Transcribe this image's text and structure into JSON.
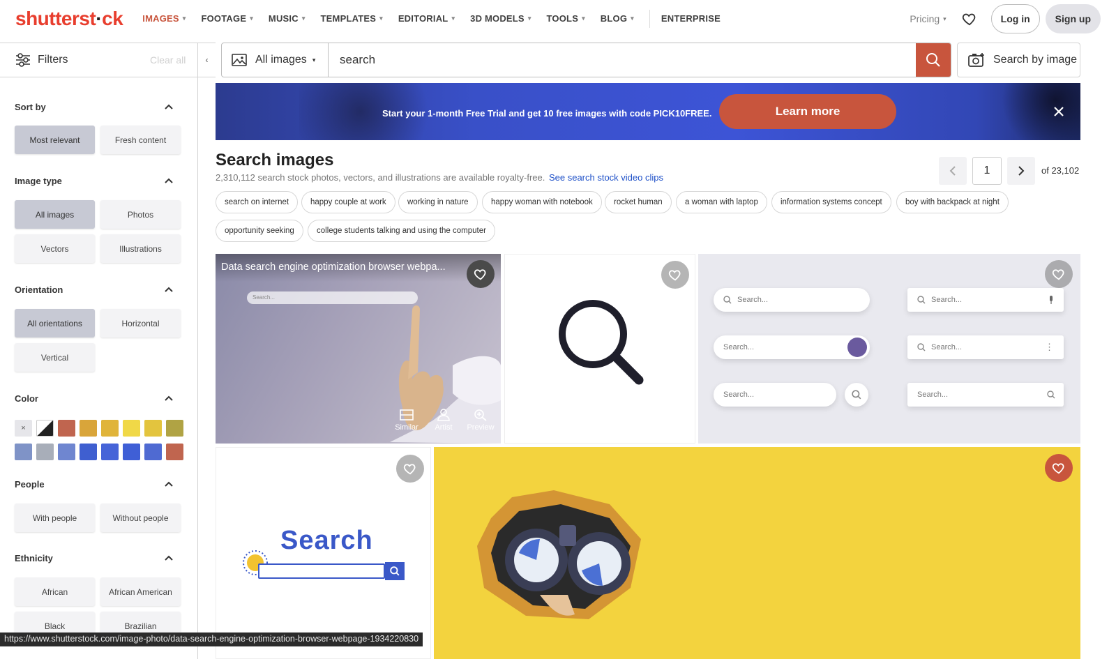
{
  "brand": {
    "logo_main": "shutterst",
    "logo_mid": "ck",
    "accent": "#c8553d",
    "logo_red": "#e83e2e"
  },
  "nav": {
    "items": [
      {
        "label": "IMAGES",
        "active": true,
        "caret": true
      },
      {
        "label": "FOOTAGE",
        "caret": true
      },
      {
        "label": "MUSIC",
        "caret": true
      },
      {
        "label": "TEMPLATES",
        "caret": true
      },
      {
        "label": "EDITORIAL",
        "caret": true
      },
      {
        "label": "3D MODELS",
        "caret": true
      },
      {
        "label": "TOOLS",
        "caret": true
      },
      {
        "label": "BLOG",
        "caret": true
      }
    ],
    "enterprise": "ENTERPRISE",
    "pricing": "Pricing",
    "login": "Log in",
    "signup": "Sign up"
  },
  "filters": {
    "title": "Filters",
    "clear_all": "Clear all",
    "sort": {
      "label": "Sort by",
      "options": [
        "Most relevant",
        "Fresh content"
      ],
      "selected": "Most relevant"
    },
    "image_type": {
      "label": "Image type",
      "options": [
        "All images",
        "Photos",
        "Vectors",
        "Illustrations"
      ],
      "selected": "All images"
    },
    "orientation": {
      "label": "Orientation",
      "options": [
        "All orientations",
        "Horizontal",
        "Vertical"
      ],
      "selected": "All orientations"
    },
    "color": {
      "label": "Color",
      "clear_glyph": "×",
      "swatches_row1": [
        "#ffffff/#222222",
        "#c0654f",
        "#d9a53a",
        "#e0b43a",
        "#f0d847",
        "#e3c43e",
        "#b0a344"
      ],
      "swatches_row2": [
        "#7f93c7",
        "#a8aeb9",
        "#6f86d0",
        "#3f5fd0",
        "#4664d8",
        "#3f5fd6",
        "#4f6ad2",
        "#c0654f"
      ]
    },
    "people": {
      "label": "People",
      "options": [
        "With people",
        "Without people"
      ]
    },
    "ethnicity": {
      "label": "Ethnicity",
      "options": [
        "African",
        "African American",
        "Black",
        "Brazilian"
      ]
    }
  },
  "search": {
    "type_label": "All images",
    "query": "search",
    "by_image": "Search by image"
  },
  "promo": {
    "text": "Start your 1-month Free Trial and get 10 free images with code PICK10FREE.",
    "cta": "Learn more"
  },
  "results": {
    "title": "Search images",
    "subtitle": "2,310,112 search stock photos, vectors, and illustrations are available royalty-free.",
    "video_link": "See search stock video clips",
    "page": "1",
    "of_pages": "of 23,102"
  },
  "related": [
    "search on internet",
    "happy couple at work",
    "working in nature",
    "happy woman with notebook",
    "rocket human",
    "a woman with laptop",
    "information systems concept",
    "boy with backpack at night",
    "opportunity seeking",
    "college students talking and using the computer"
  ],
  "tiles": {
    "first_caption": "Data search engine optimization browser webpa...",
    "first_mock_search": "Search...",
    "actions": [
      "Similar",
      "Artist",
      "Preview"
    ],
    "mock_search_placeholders": [
      "Search...",
      "Search...",
      "Search...",
      "Search...",
      "Search...",
      "Search..."
    ],
    "search_logo_text": "Search"
  },
  "statusbar": {
    "url": "https://www.shutterstock.com/image-photo/data-search-engine-optimization-browser-webpage-1934220830"
  }
}
